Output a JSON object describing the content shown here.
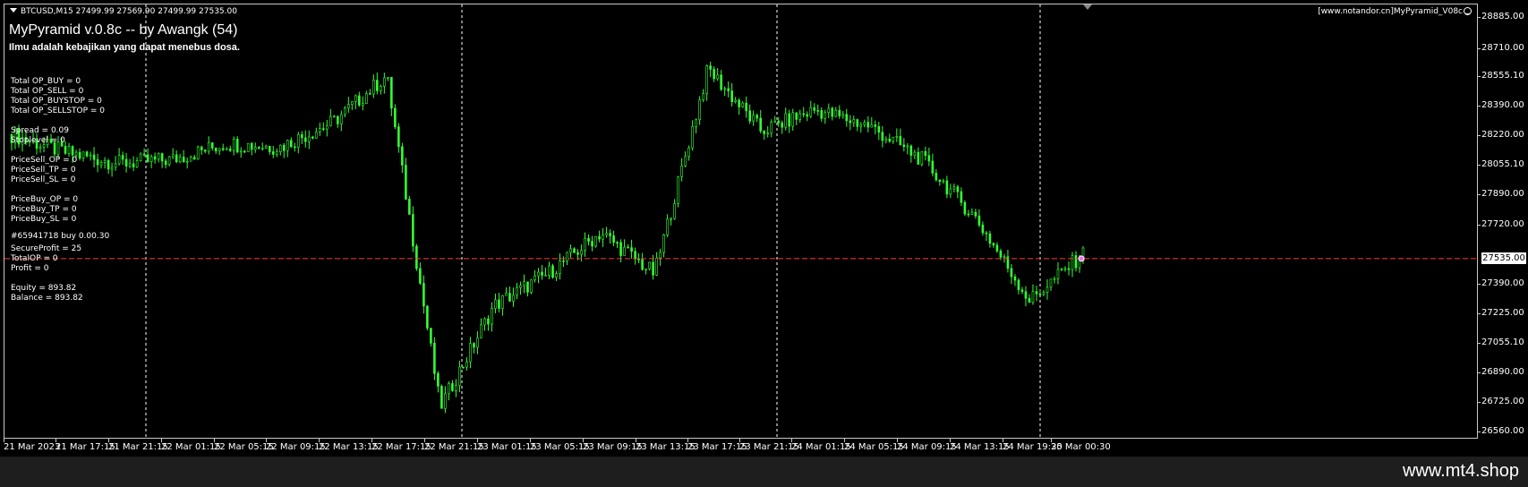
{
  "symbol_header": "BTCUSD,M15  27499.99 27569.90 27499.99 27535.00",
  "ea": {
    "title": "MyPyramid v.0.8c -- by Awangk (54)",
    "motto": "Ilmu adalah kebajikan yang dapat menebus dosa.",
    "corner_label": "[www.notandor.cn]MyPyramid_V08c"
  },
  "stats": {
    "group1": [
      "Total OP_BUY = 0",
      "Total OP_SELL = 0",
      "Total OP_BUYSTOP = 0",
      "Total OP_SELLSTOP = 0"
    ],
    "group2": [
      "Spread = 0.09",
      "Stoplevel = 0"
    ],
    "group3": [
      "PriceSell_OP = 0",
      "PriceSell_TP = 0",
      "PriceSell_SL = 0"
    ],
    "group4": [
      "PriceBuy_OP = 0",
      "PriceBuy_TP = 0",
      "PriceBuy_SL = 0"
    ],
    "group5_overlap": "#65941718 buy 0.00.30",
    "group5": [
      "SecureProfit = 25",
      "TotalOP = 0",
      "Profit = 0"
    ],
    "group6": [
      "Equity = 893.82",
      "Balance = 893.82"
    ]
  },
  "price_axis": [
    "28885.00",
    "28710.00",
    "28555.10",
    "28390.00",
    "28220.00",
    "28055.10",
    "27890.00",
    "27720.00",
    "27390.00",
    "27225.00",
    "27055.10",
    "26890.00",
    "26725.00",
    "26560.00"
  ],
  "current_price": "27535.00",
  "time_axis": [
    "21 Mar 2023",
    "21 Mar 17:15",
    "21 Mar 21:15",
    "22 Mar 01:15",
    "22 Mar 05:15",
    "22 Mar 09:15",
    "22 Mar 13:15",
    "22 Mar 17:15",
    "22 Mar 21:15",
    "23 Mar 01:15",
    "23 Mar 05:15",
    "23 Mar 09:15",
    "23 Mar 13:15",
    "23 Mar 17:15",
    "23 Mar 21:15",
    "24 Mar 01:15",
    "24 Mar 05:15",
    "24 Mar 09:15",
    "24 Mar 13:15",
    "24 Mar 19:30",
    "25 Mar 00:30"
  ],
  "footer_brand": "www.mt4.shop",
  "colors": {
    "candle": "#33ff33",
    "price_line": "#ff3b3b",
    "grid": "#ffffff",
    "background": "#000000"
  },
  "chart_data": {
    "type": "line",
    "x": [
      "21 Mar 2023",
      "21 Mar 17:15",
      "21 Mar 21:15",
      "22 Mar 01:15",
      "22 Mar 05:15",
      "22 Mar 09:15",
      "22 Mar 13:15",
      "22 Mar 17:15",
      "22 Mar 21:15",
      "23 Mar 01:15",
      "23 Mar 05:15",
      "23 Mar 09:15",
      "23 Mar 13:15",
      "23 Mar 17:15",
      "23 Mar 21:15",
      "24 Mar 01:15",
      "24 Mar 05:15",
      "24 Mar 09:15",
      "24 Mar 13:15",
      "24 Mar 19:30",
      "25 Mar 00:30"
    ],
    "values": [
      28230,
      28130,
      28070,
      28090,
      28180,
      28160,
      28300,
      28560,
      26700,
      27270,
      27450,
      27680,
      27450,
      28600,
      28250,
      28370,
      28280,
      28090,
      27760,
      27300,
      27560
    ],
    "current_price": 27535,
    "ylim": [
      26520,
      28960
    ],
    "grid": true
  }
}
